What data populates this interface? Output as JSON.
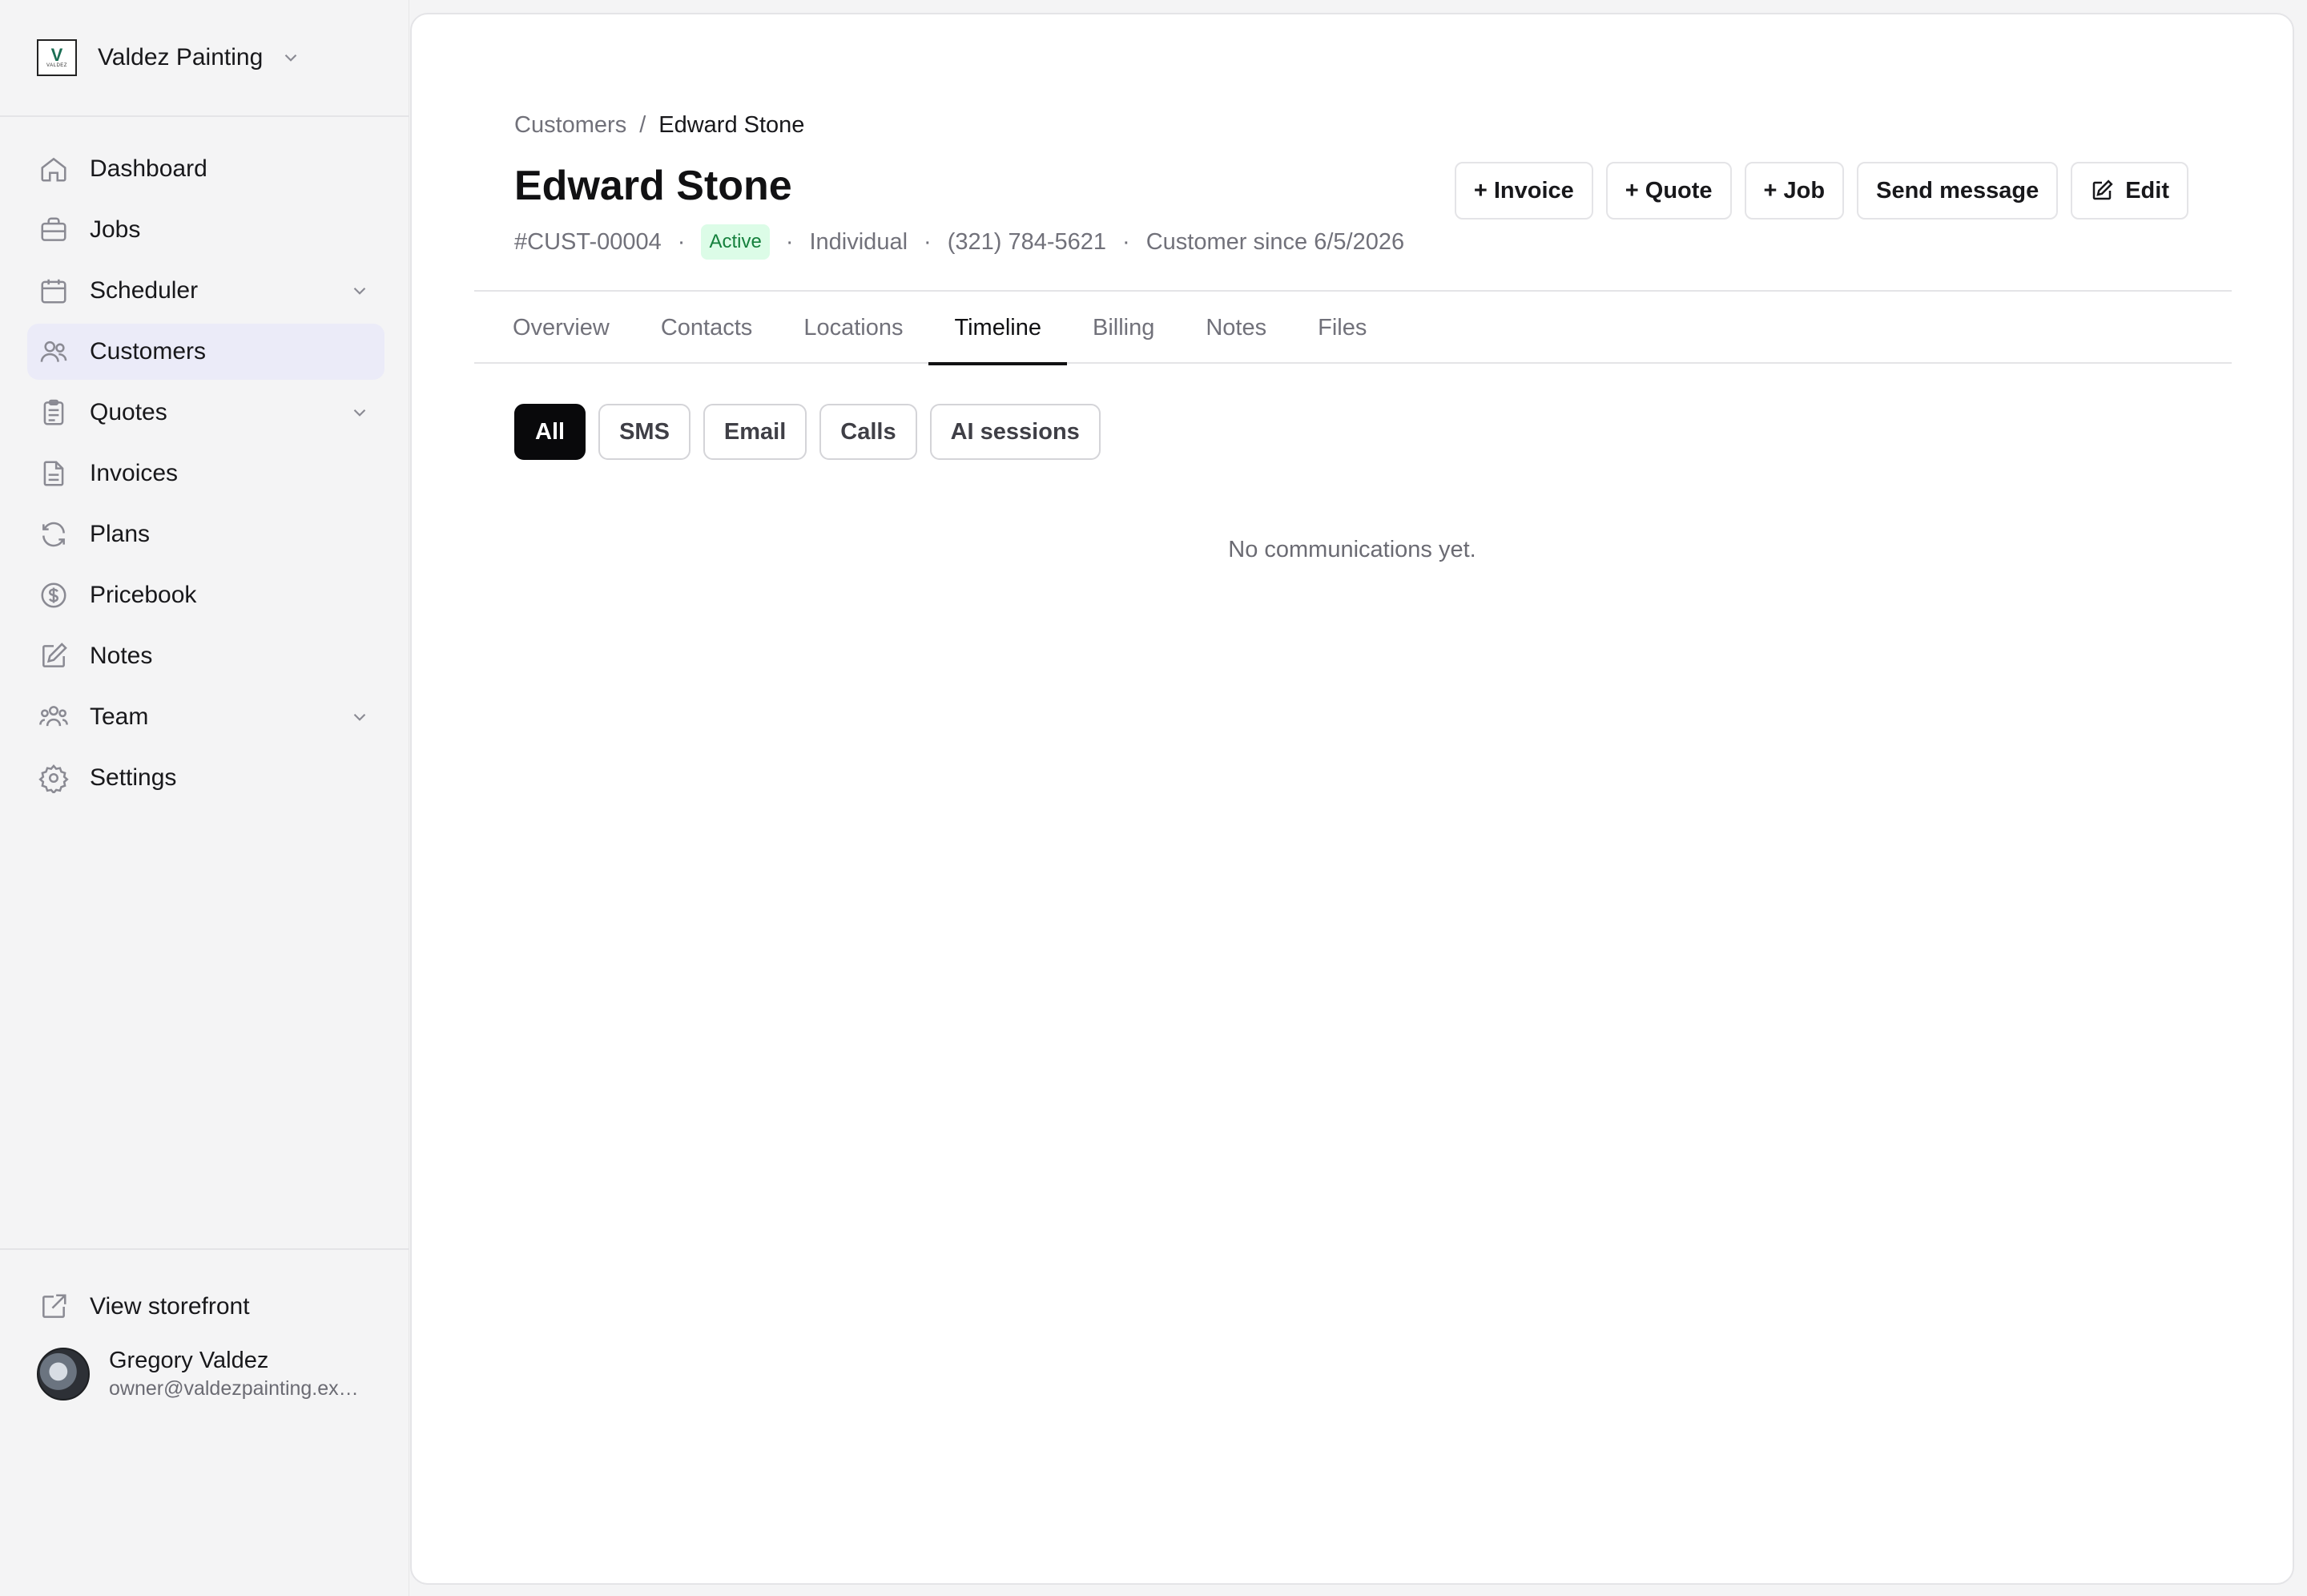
{
  "org": {
    "name": "Valdez Painting",
    "logo_letter": "V",
    "logo_text": "VALDEZ"
  },
  "nav": {
    "items": [
      {
        "label": "Dashboard"
      },
      {
        "label": "Jobs"
      },
      {
        "label": "Scheduler"
      },
      {
        "label": "Customers"
      },
      {
        "label": "Quotes"
      },
      {
        "label": "Invoices"
      },
      {
        "label": "Plans"
      },
      {
        "label": "Pricebook"
      },
      {
        "label": "Notes"
      },
      {
        "label": "Team"
      },
      {
        "label": "Settings"
      }
    ],
    "active": "Customers"
  },
  "storefront": {
    "label": "View storefront"
  },
  "user": {
    "name": "Gregory Valdez",
    "email": "owner@valdezpainting.example.com"
  },
  "breadcrumb": {
    "parent": "Customers",
    "separator": "/",
    "current": "Edward Stone"
  },
  "customer": {
    "name": "Edward Stone",
    "id": "#CUST-00004",
    "status": "Active",
    "type": "Individual",
    "phone": "(321) 784-5621",
    "since": "Customer since 6/5/2026",
    "dot": "·"
  },
  "actions": {
    "invoice": "+ Invoice",
    "quote": "+ Quote",
    "job": "+ Job",
    "message": "Send message",
    "edit": "Edit"
  },
  "tabs": {
    "overview": "Overview",
    "contacts": "Contacts",
    "locations": "Locations",
    "timeline": "Timeline",
    "billing": "Billing",
    "notes": "Notes",
    "files": "Files",
    "active": "Timeline"
  },
  "filters": {
    "all": "All",
    "sms": "SMS",
    "email": "Email",
    "calls": "Calls",
    "ai": "AI sessions",
    "active": "All"
  },
  "timeline": {
    "empty_message": "No communications yet."
  },
  "colors": {
    "accent_active_nav": "#ebebf8",
    "status_active_bg": "#dcfce7",
    "status_active_fg": "#15803d",
    "filter_active": "#09090b"
  }
}
